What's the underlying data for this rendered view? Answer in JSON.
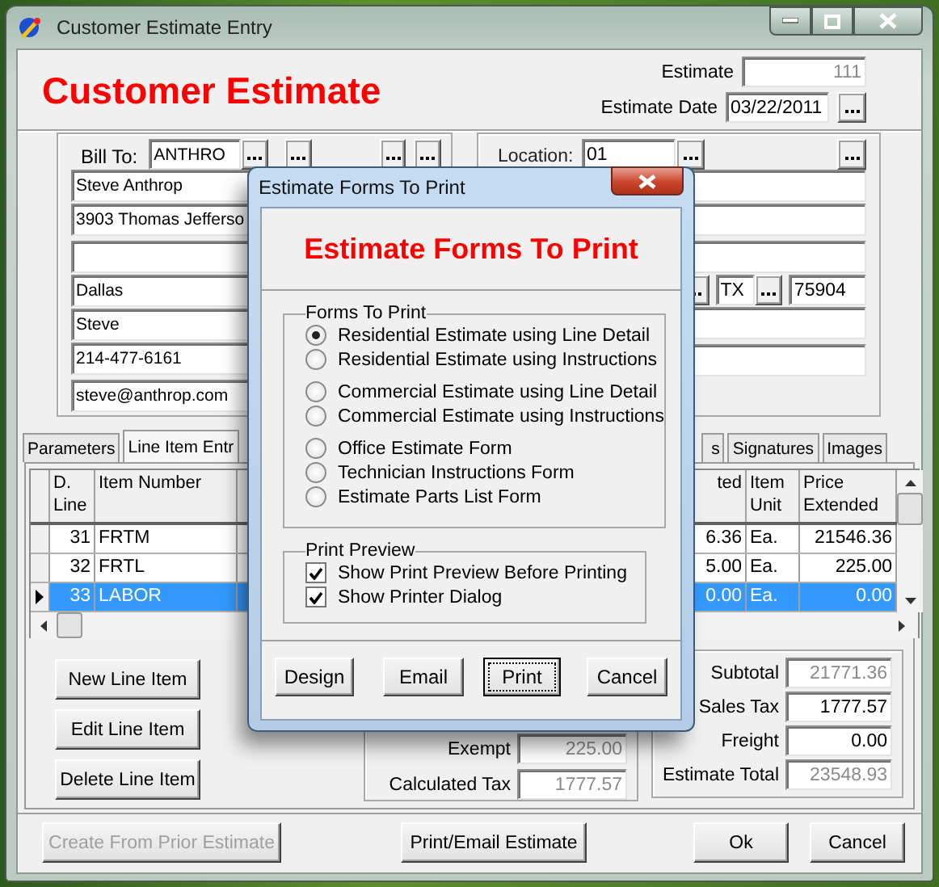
{
  "window": {
    "title": "Customer Estimate Entry"
  },
  "header": {
    "title": "Customer Estimate",
    "estimate_label": "Estimate",
    "estimate": "111",
    "date_label": "Estimate Date",
    "date": "03/22/2011"
  },
  "bill_to": {
    "label": "Bill To:",
    "code": "ANTHRO",
    "name_fields": [
      "Steve Anthrop",
      "3903 Thomas Jefferso"
    ],
    "city_fields": [
      "Dallas",
      "Steve",
      "214-477-6161"
    ],
    "email": "steve@anthrop.com"
  },
  "ship_to": {
    "label": "Location:",
    "code": "01",
    "state": "TX",
    "zip": "75904"
  },
  "tabs": [
    {
      "label": "Parameters",
      "selected": false
    },
    {
      "label": "Line Item Entr",
      "selected": true
    },
    {
      "label": "s",
      "selected": false
    },
    {
      "label": "Signatures",
      "selected": false
    },
    {
      "label": "Images",
      "selected": false
    }
  ],
  "grid": {
    "columns": [
      "D. Line",
      "Item Number",
      "ted",
      "Item Unit",
      "Price Extended"
    ],
    "rows": [
      {
        "line": "31",
        "item": "FRTM",
        "column_4": "6.36",
        "unit": "Ea.",
        "price": "21546.36",
        "selected": false
      },
      {
        "line": "32",
        "item": "FRTL",
        "column_4": "5.00",
        "unit": "Ea.",
        "price": "225.00",
        "selected": false
      },
      {
        "line": "33",
        "item": "LABOR",
        "column_4": "0.00",
        "unit": "Ea.",
        "price": "0.00",
        "selected": true
      }
    ]
  },
  "line_buttons": [
    "New Line Item",
    "Edit Line Item",
    "Delete Line Item"
  ],
  "tax": [
    {
      "label": "Exempt",
      "value": "225.00",
      "readonly": true
    },
    {
      "label": "Calculated Tax",
      "value": "1777.57",
      "readonly": true
    }
  ],
  "totals": [
    {
      "label": "Subtotal",
      "value": "21771.36",
      "readonly": true
    },
    {
      "label": "Sales Tax",
      "value": "1777.57",
      "readonly": false
    },
    {
      "label": "Freight",
      "value": "0.00",
      "readonly": false
    },
    {
      "label": "Estimate Total",
      "value": "23548.93",
      "readonly": true
    }
  ],
  "footer_buttons": [
    {
      "label": "Create From Prior Estimate",
      "disabled": true
    },
    {
      "label": "Print/Email Estimate",
      "disabled": false
    },
    {
      "label": "Ok",
      "disabled": false
    },
    {
      "label": "Cancel",
      "disabled": false
    }
  ],
  "dialog": {
    "title": "Estimate Forms To Print",
    "heading": "Estimate Forms To Print",
    "forms": {
      "label": "Forms To Print",
      "groups": [
        {
          "options": [
            {
              "label": "Residential Estimate using Line Detail",
              "selected": true
            },
            {
              "label": "Residential Estimate using Instructions",
              "selected": false
            }
          ]
        },
        {
          "options": [
            {
              "label": "Commercial Estimate using Line Detail",
              "selected": false
            },
            {
              "label": "Commercial Estimate using Instructions",
              "selected": false
            }
          ]
        },
        {
          "options": [
            {
              "label": "Office Estimate Form",
              "selected": false
            },
            {
              "label": "Technician Instructions Form",
              "selected": false
            },
            {
              "label": "Estimate Parts List Form",
              "selected": false
            }
          ]
        }
      ]
    },
    "preview": {
      "label": "Print Preview",
      "options": [
        {
          "label": "Show Print Preview Before Printing",
          "checked": true
        },
        {
          "label": "Show Printer Dialog",
          "checked": true
        }
      ]
    },
    "buttons": [
      {
        "label": "Design",
        "focused": false
      },
      {
        "label": "Email",
        "focused": false
      },
      {
        "label": "Print",
        "focused": true
      },
      {
        "label": "Cancel",
        "focused": false
      }
    ]
  }
}
